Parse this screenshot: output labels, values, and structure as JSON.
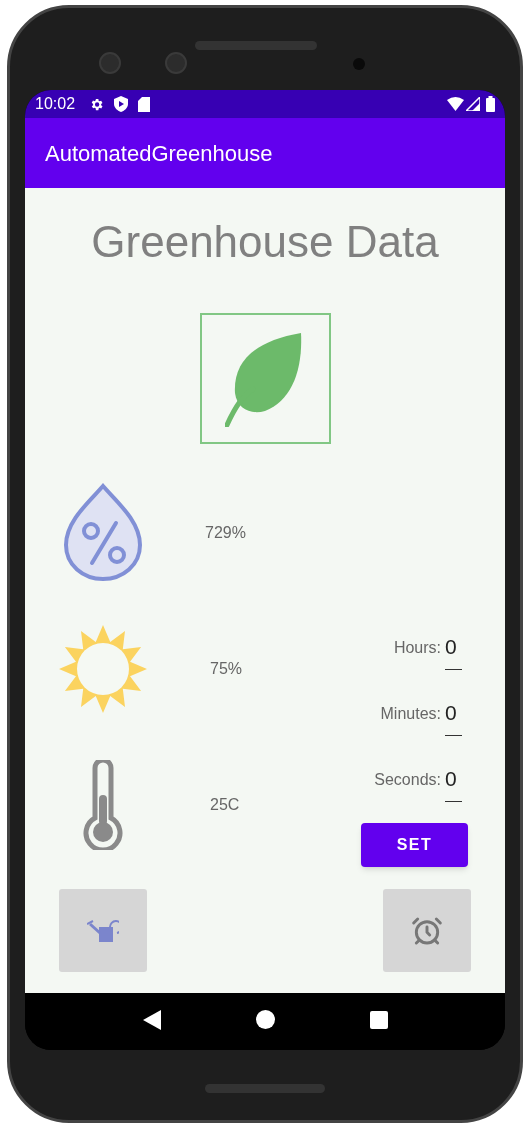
{
  "status_bar": {
    "time": "10:02"
  },
  "app_bar": {
    "title": "AutomatedGreenhouse"
  },
  "heading": "Greenhouse Data",
  "readings": [
    {
      "kind": "humidity",
      "value": "729%"
    },
    {
      "kind": "light",
      "value": "75%"
    },
    {
      "kind": "temperature",
      "value": "25C"
    }
  ],
  "timer": {
    "fields": [
      {
        "label": "Hours:",
        "value": "0"
      },
      {
        "label": "Minutes:",
        "value": "0"
      },
      {
        "label": "Seconds:",
        "value": "0"
      }
    ],
    "button": "SET"
  },
  "actions": [
    {
      "kind": "water"
    },
    {
      "kind": "alarm"
    }
  ]
}
